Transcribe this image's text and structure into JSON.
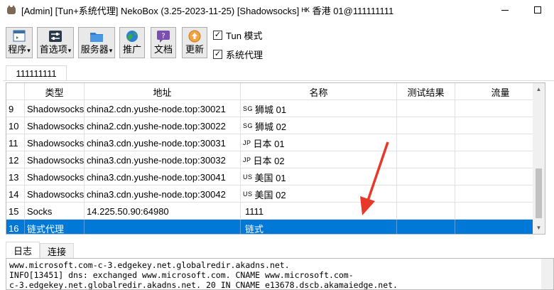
{
  "window": {
    "title": "[Admin] [Tun+系统代理] NekoBox (3.25-2023-11-25) [Shadowsocks] ᴴᴷ 香港 01@111111111",
    "minimize": "—",
    "maximize": "□"
  },
  "toolbar": {
    "program_label": "程序",
    "preferences_label": "首选项",
    "server_label": "服务器",
    "promote_label": "推广",
    "docs_label": "文档",
    "update_label": "更新",
    "tun_label": "Tun 模式",
    "tun_checked": "✓",
    "sysproxy_label": "系统代理",
    "sysproxy_checked": "✓"
  },
  "group_tab": {
    "label": "111111111"
  },
  "table": {
    "headers": {
      "type": "类型",
      "address": "地址",
      "name": "名称",
      "test": "测试结果",
      "traffic": "流量"
    },
    "rows": [
      {
        "num": "9",
        "type": "Shadowsocks",
        "address": "china2.cdn.yushe-node.top:30021",
        "flag": "SG",
        "name": "狮城 01",
        "test": "",
        "traffic": ""
      },
      {
        "num": "10",
        "type": "Shadowsocks",
        "address": "china2.cdn.yushe-node.top:30022",
        "flag": "SG",
        "name": "狮城 02",
        "test": "",
        "traffic": ""
      },
      {
        "num": "11",
        "type": "Shadowsocks",
        "address": "china3.cdn.yushe-node.top:30031",
        "flag": "JP",
        "name": "日本 01",
        "test": "",
        "traffic": ""
      },
      {
        "num": "12",
        "type": "Shadowsocks",
        "address": "china3.cdn.yushe-node.top:30032",
        "flag": "JP",
        "name": "日本 02",
        "test": "",
        "traffic": ""
      },
      {
        "num": "13",
        "type": "Shadowsocks",
        "address": "china3.cdn.yushe-node.top:30041",
        "flag": "US",
        "name": "美国 01",
        "test": "",
        "traffic": ""
      },
      {
        "num": "14",
        "type": "Shadowsocks",
        "address": "china3.cdn.yushe-node.top:30042",
        "flag": "US",
        "name": "美国 02",
        "test": "",
        "traffic": ""
      },
      {
        "num": "15",
        "type": "Socks",
        "address": "14.225.50.90:64980",
        "flag": "",
        "name": "1111",
        "test": "",
        "traffic": ""
      },
      {
        "num": "16",
        "type": "链式代理",
        "address": "",
        "flag": "",
        "name": "链式",
        "test": "",
        "traffic": ""
      }
    ]
  },
  "log": {
    "tab_log": "日志",
    "tab_conn": "连接",
    "line1": "www.microsoft.com-c-3.edgekey.net.globalredir.akadns.net.",
    "line2": "INFO[13451] dns: exchanged www.microsoft.com. CNAME www.microsoft.com-",
    "line3": "c-3.edgekey.net.globalredir.akadns.net. 20 IN CNAME e13678.dscb.akamaiedge.net."
  },
  "colors": {
    "selection": "#0078d7",
    "annotation_arrow": "#e8382b"
  }
}
